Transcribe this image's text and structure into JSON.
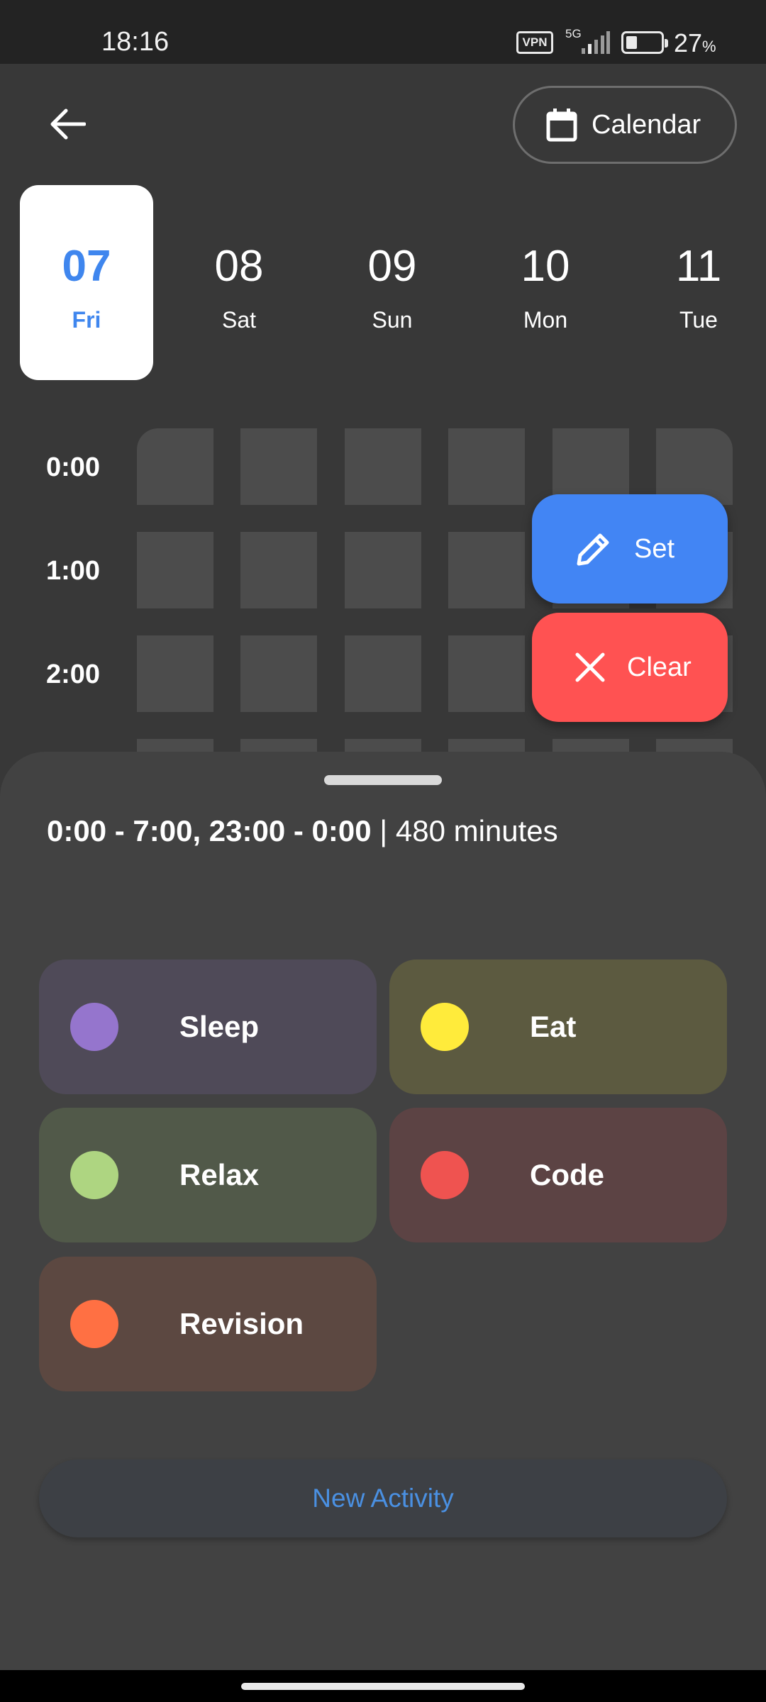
{
  "status_bar": {
    "time": "18:16",
    "vpn": "VPN",
    "network": "5G",
    "battery_percent": "27",
    "battery_unit": "%",
    "battery_level": 0.27
  },
  "header": {
    "back_icon": "arrow-left-icon",
    "calendar_icon": "calendar-icon",
    "calendar_label": "Calendar"
  },
  "days": [
    {
      "num": "07",
      "dow": "Fri",
      "selected": true
    },
    {
      "num": "08",
      "dow": "Sat",
      "selected": false
    },
    {
      "num": "09",
      "dow": "Sun",
      "selected": false
    },
    {
      "num": "10",
      "dow": "Mon",
      "selected": false
    },
    {
      "num": "11",
      "dow": "Tue",
      "selected": false
    }
  ],
  "hours": [
    "0:00",
    "1:00",
    "2:00"
  ],
  "actions": {
    "set_label": "Set",
    "set_icon": "pencil-icon",
    "clear_label": "Clear",
    "clear_icon": "close-icon"
  },
  "sheet": {
    "range": "0:00 - 7:00, 23:00 - 0:00",
    "separator": "|",
    "minutes": "480 minutes"
  },
  "activities": [
    {
      "name": "Sleep",
      "color": "#9575cd",
      "bg": "#4f4a58"
    },
    {
      "name": "Eat",
      "color": "#ffeb3b",
      "bg": "#5c5a40"
    },
    {
      "name": "Relax",
      "color": "#aed581",
      "bg": "#515949"
    },
    {
      "name": "Code",
      "color": "#ef5350",
      "bg": "#5c4344"
    },
    {
      "name": "Revision",
      "color": "#ff7043",
      "bg": "#5c4841"
    }
  ],
  "new_activity_label": "New Activity",
  "colors": {
    "accent": "#3f86ee",
    "set": "#4285f4",
    "clear": "#ff5252"
  }
}
